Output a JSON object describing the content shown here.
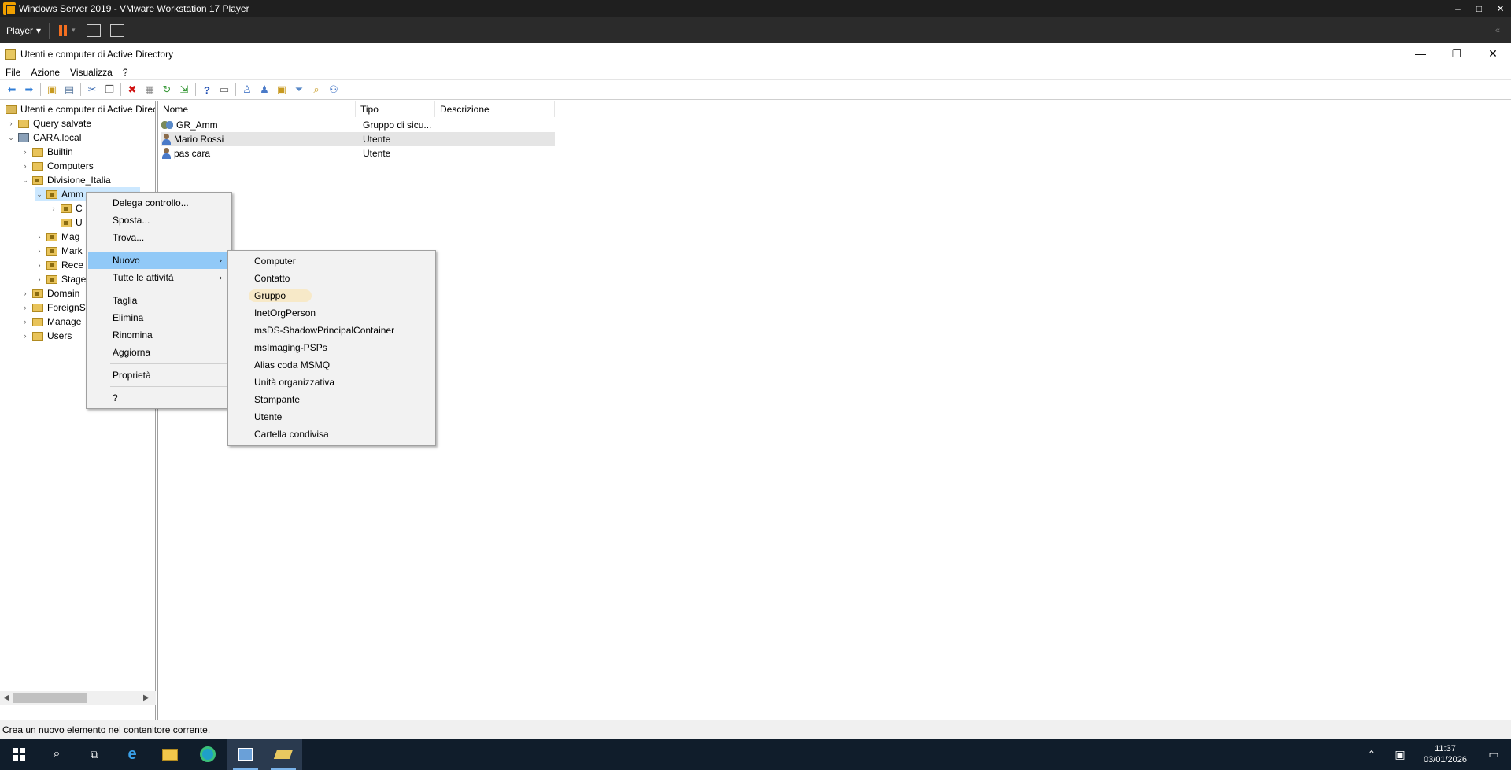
{
  "vm": {
    "title": "Windows Server 2019 - VMware Workstation 17 Player",
    "player_label": "Player",
    "window_controls": [
      "–",
      "□",
      "✕"
    ]
  },
  "app": {
    "title": "Utenti e computer di Active Directory",
    "menu": [
      "File",
      "Azione",
      "Visualizza",
      "?"
    ]
  },
  "tree": {
    "root": "Utenti e computer di Active Directory",
    "items": [
      {
        "label": "Query salvate",
        "level": 1
      },
      {
        "label": "CARA.local",
        "level": 1
      },
      {
        "label": "Builtin",
        "level": 2
      },
      {
        "label": "Computers",
        "level": 2
      },
      {
        "label": "Divisione_Italia",
        "level": 2
      },
      {
        "label": "Amm",
        "level": 3
      },
      {
        "label": "C",
        "level": 4
      },
      {
        "label": "U",
        "level": 4
      },
      {
        "label": "Mag",
        "level": 3
      },
      {
        "label": "Mark",
        "level": 3
      },
      {
        "label": "Rece",
        "level": 3
      },
      {
        "label": "Stage",
        "level": 3
      },
      {
        "label": "Domain",
        "level": 2
      },
      {
        "label": "ForeignS",
        "level": 2
      },
      {
        "label": "Manage",
        "level": 2
      },
      {
        "label": "Users",
        "level": 2
      }
    ]
  },
  "list": {
    "columns": [
      "Nome",
      "Tipo",
      "Descrizione"
    ],
    "rows": [
      {
        "name": "GR_Amm",
        "type": "Gruppo di sicu...",
        "desc": ""
      },
      {
        "name": "Mario Rossi",
        "type": "Utente",
        "desc": ""
      },
      {
        "name": "pas cara",
        "type": "Utente",
        "desc": ""
      }
    ]
  },
  "context_menu": {
    "items": [
      "Delega controllo...",
      "Sposta...",
      "Trova...",
      "Nuovo",
      "Tutte le attività",
      "Taglia",
      "Elimina",
      "Rinomina",
      "Aggiorna",
      "Proprietà",
      "?"
    ]
  },
  "submenu": {
    "items": [
      "Computer",
      "Contatto",
      "Gruppo",
      "InetOrgPerson",
      "msDS-ShadowPrincipalContainer",
      "msImaging-PSPs",
      "Alias coda MSMQ",
      "Unità organizzativa",
      "Stampante",
      "Utente",
      "Cartella condivisa"
    ]
  },
  "status": "Crea un nuovo elemento nel contenitore corrente.",
  "clock": {
    "time": "11:37",
    "date": "03/01/2026"
  }
}
